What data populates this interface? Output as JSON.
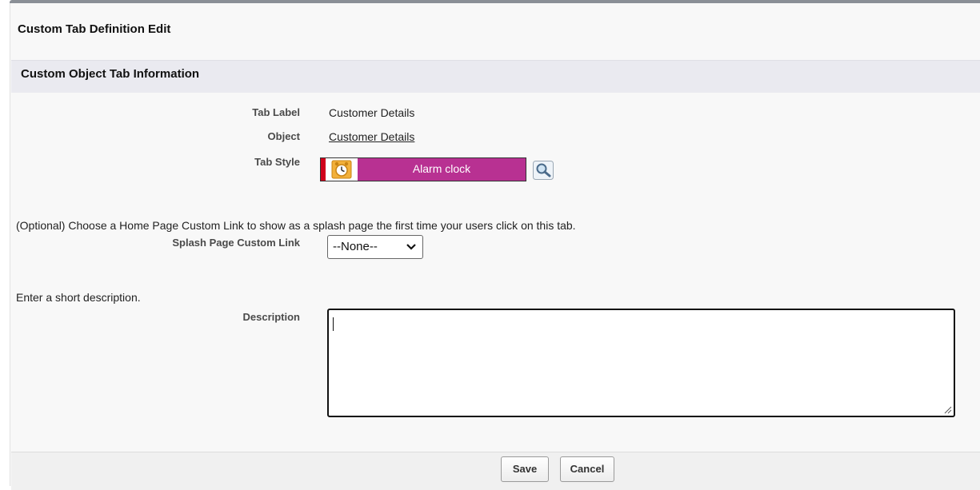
{
  "page": {
    "title": "Custom Tab Definition Edit"
  },
  "section": {
    "title": "Custom Object Tab Information"
  },
  "fields": {
    "tab_label": {
      "label": "Tab Label",
      "value": "Customer Details"
    },
    "object": {
      "label": "Object",
      "value": "Customer Details"
    },
    "tab_style": {
      "label": "Tab Style",
      "value": "Alarm clock",
      "icon": "alarm-clock-icon",
      "color": "#b83192"
    }
  },
  "splash": {
    "help_text": "(Optional) Choose a Home Page Custom Link to show as a splash page the first time your users click on this tab.",
    "label": "Splash Page Custom Link",
    "selected": "--None--"
  },
  "description": {
    "help_text": "Enter a short description.",
    "label": "Description",
    "value": ""
  },
  "buttons": {
    "save": "Save",
    "cancel": "Cancel"
  }
}
